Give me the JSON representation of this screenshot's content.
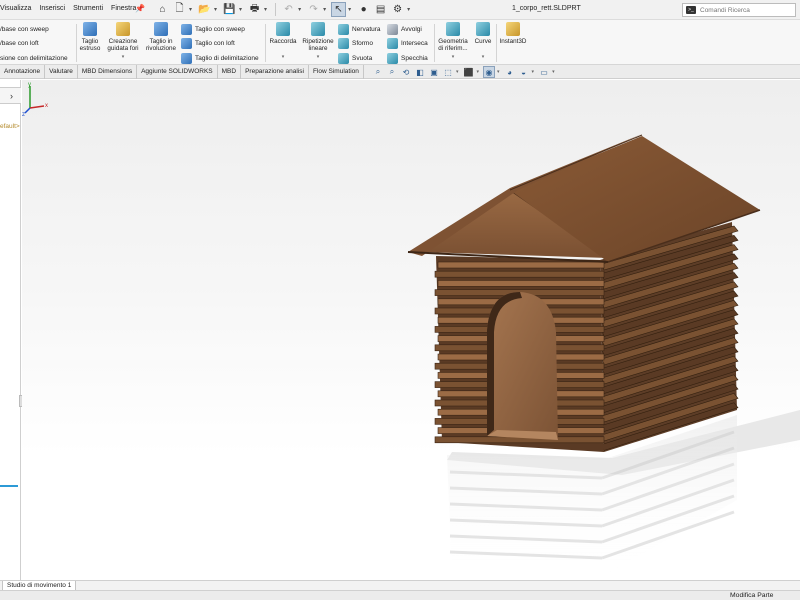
{
  "menu": {
    "items": [
      "Visualizza",
      "Inserisci",
      "Strumenti",
      "Finestra"
    ],
    "pin_icon": "pin-icon"
  },
  "quick_toolbar": {
    "icons": [
      "home-icon",
      "new-document-icon",
      "open-folder-icon",
      "save-icon",
      "print-icon",
      "undo-icon",
      "redo-icon",
      "select-cursor-icon",
      "traffic-light-icon",
      "file-properties-icon",
      "options-gear-icon"
    ]
  },
  "document": {
    "title": "1_corpo_rett.SLDPRT"
  },
  "search": {
    "placeholder": "Comandi Ricerca"
  },
  "ribbon": {
    "left_column": [
      "/base con sweep",
      "/base con loft",
      "sione con delimitazione"
    ],
    "extruded_cut": "Taglio estruso",
    "hole_wizard": "Creazione guidata fori",
    "revolved_cut": "Taglio in rivoluzione",
    "cut_column": [
      "Taglio con sweep",
      "Taglio con loft",
      "Taglio di delimitazione"
    ],
    "fillet": "Raccorda",
    "linear_pattern": "Ripetizione lineare",
    "features_column": [
      "Nervatura",
      "Sformo",
      "Svuota"
    ],
    "features_column2": [
      "Avvolgi",
      "Interseca",
      "Specchia"
    ],
    "reference_geometry": "Geometria di riferim...",
    "curves": "Curve",
    "instant3d": "Instant3D"
  },
  "tabs": [
    "Annotazione",
    "Valutare",
    "MBD Dimensions",
    "Aggiunte SOLIDWORKS",
    "MBD",
    "Preparazione analisi",
    "Flow Simulation"
  ],
  "feature_tree": {
    "config_label": "efault>"
  },
  "motion_tab": "Studio di movimento 1",
  "status": {
    "mode": "Modifica Parte"
  },
  "colors": {
    "wood_dark": "#5a3a24",
    "wood_mid": "#7a5232",
    "wood_light": "#9b6b45",
    "accent_blue": "#2c9ad6"
  }
}
